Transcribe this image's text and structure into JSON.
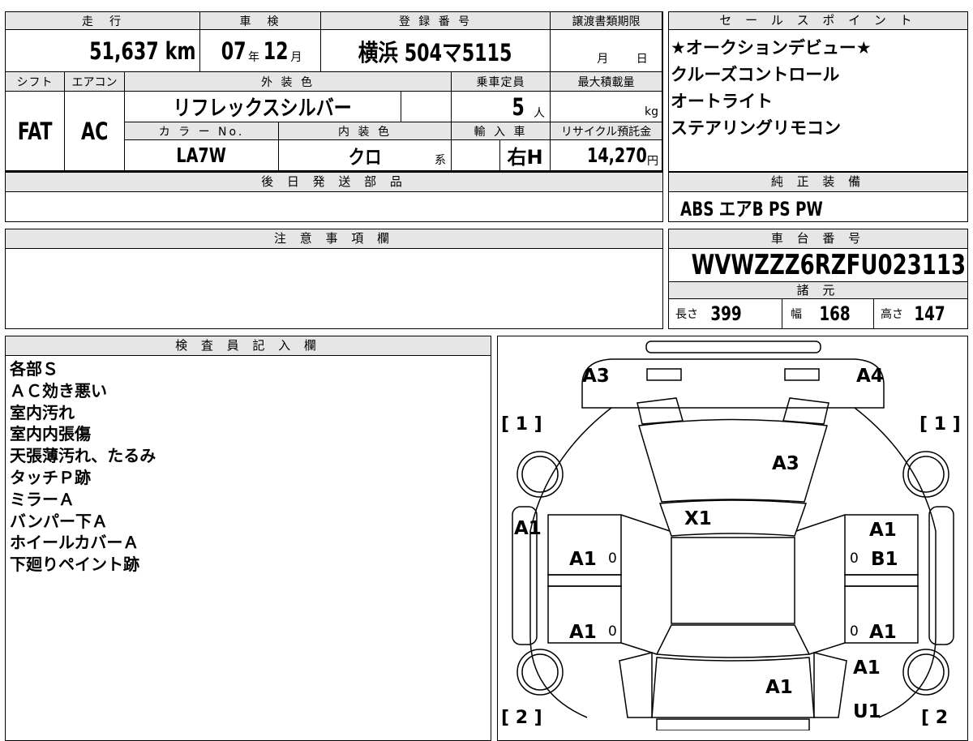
{
  "vehicle": {
    "labels": {
      "mileage": "走　行",
      "inspection": "車　検",
      "registration": "登 録 番 号",
      "transfer_deadline": "譲渡書類期限",
      "shift": "シフト",
      "aircon": "エアコン",
      "exterior_color": "外 装 色",
      "capacity": "乗車定員",
      "max_load": "最大積載量",
      "color_no": "カ ラ ー No.",
      "interior_color": "内 装 色",
      "import": "輸 入 車",
      "recycle": "リサイクル預託金",
      "later_parts": "後 日 発 送 部 品",
      "caution": "注 意 事 項 欄",
      "inspector": "検 査 員 記 入 欄"
    },
    "mileage_value": "51,637",
    "mileage_unit": "km",
    "inspection_year": "07",
    "inspection_year_unit": "年",
    "inspection_month": "12",
    "inspection_month_unit": "月",
    "registration_value": "横浜 504マ5115",
    "deadline_month": "月",
    "deadline_day": "日",
    "shift_value": "FAT",
    "aircon_value": "AC",
    "exterior_color_value": "リフレックスシルバー",
    "capacity_value": "5",
    "capacity_unit": "人",
    "max_load_unit": "kg",
    "color_no_value": "LA7W",
    "interior_color_value": "クロ",
    "interior_color_suffix": "系",
    "import_value": "右H",
    "recycle_value": "14,270",
    "recycle_unit": "円"
  },
  "sales_points": {
    "title": "セ ー ル ス ポ イ ン ト",
    "items": [
      "★オークションデビュー★",
      "クルーズコントロール",
      "オートライト",
      "ステアリングリモコン"
    ]
  },
  "genuine_equipment": {
    "title": "純 正 装 備",
    "value": "ABS エアB PS PW"
  },
  "chassis": {
    "title": "車 台 番 号",
    "value": "WVWZZZ6RZFU023113"
  },
  "specs": {
    "title": "諸 元",
    "length_label": "長さ",
    "length_value": "399",
    "width_label": "幅",
    "width_value": "168",
    "height_label": "高さ",
    "height_value": "147"
  },
  "inspector_notes": [
    "各部Ｓ",
    "ＡＣ効き悪い",
    "室内汚れ",
    "室内内張傷",
    "天張薄汚れ、たるみ",
    "タッチＰ跡",
    "ミラーＡ",
    "バンパー下Ａ",
    "ホイールカバーＡ",
    "下廻りペイント跡"
  ],
  "diagram": {
    "marks": {
      "a3_left": "A3",
      "a4_right": "A4",
      "a3_bonnet": "A3",
      "x1_windshield": "X1",
      "a1_left_fender": "A1",
      "a1_left_front_door": "A1",
      "a1_left_rear_door": "A1",
      "a1_right_fender": "A1",
      "b1_right_front_door": "B1",
      "a1_right_rear_door": "A1",
      "a1_right_quarter": "A1",
      "a1_trunk": "A1",
      "u1_rear": "U1"
    },
    "brackets": {
      "front_left": "[ 1 ]",
      "front_right": "[ 1 ]",
      "rear_left": "[ 2 ]",
      "rear_right": "[ 2"
    }
  }
}
